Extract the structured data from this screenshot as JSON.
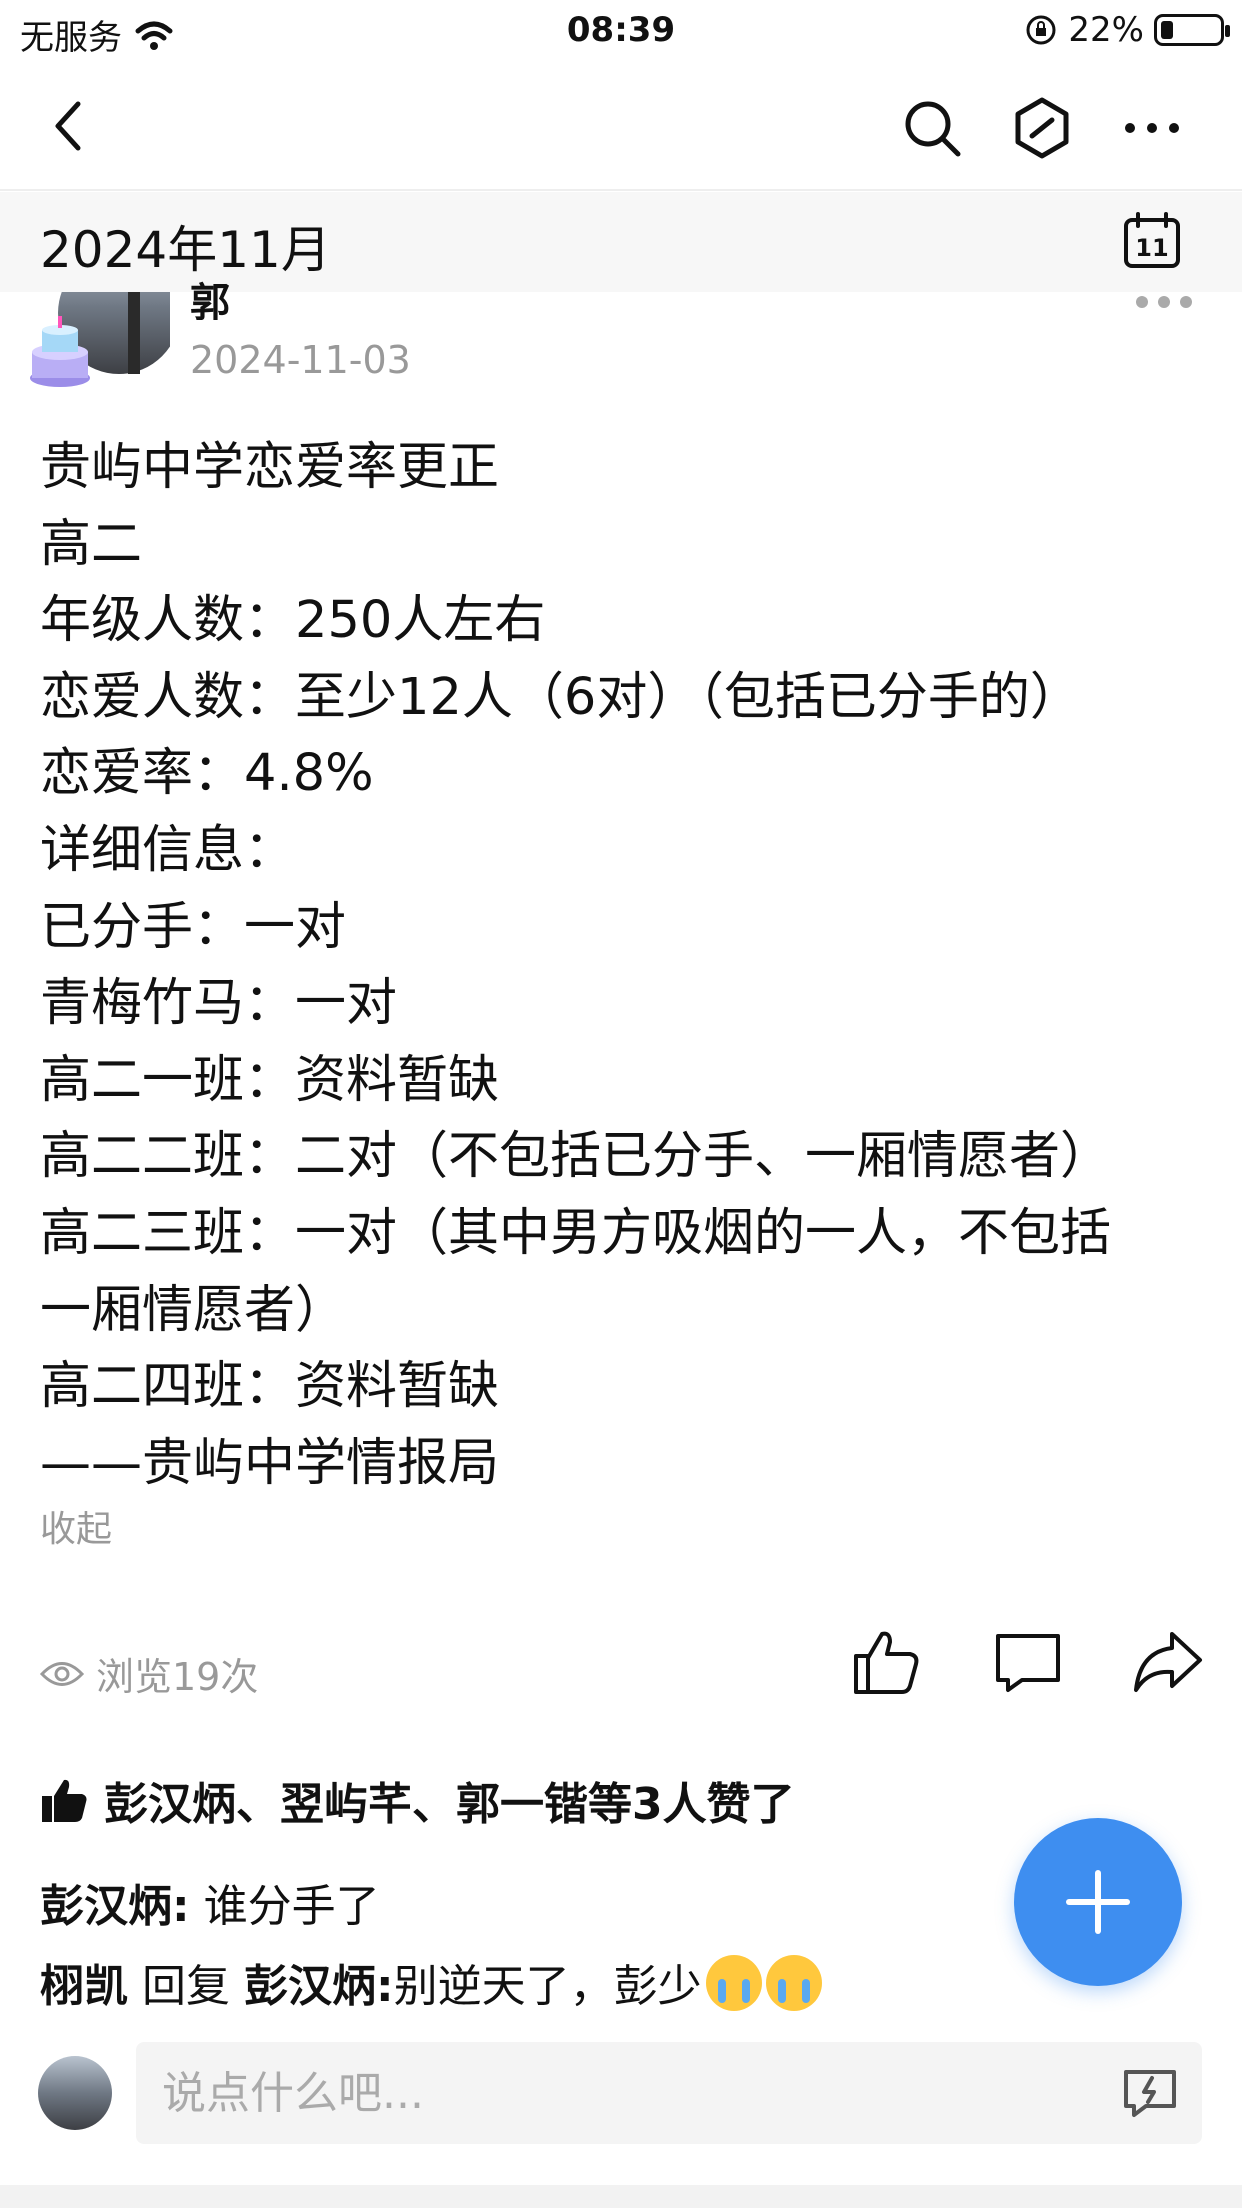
{
  "status_bar": {
    "carrier": "无服务",
    "time": "08:39",
    "battery_text": "22%",
    "battery_level": 0.22
  },
  "month_header": {
    "label": "2024年11月",
    "calendar_day": "11"
  },
  "post": {
    "author": "郭",
    "date": "2024-11-03",
    "lines": [
      "贵屿中学恋爱率更正",
      "高二",
      "年级人数：250人左右",
      "恋爱人数：至少12人（6对）（包括已分手的）",
      "恋爱率：4.8%",
      "详细信息：",
      "已分手：一对",
      "青梅竹马：一对",
      "高二一班：资料暂缺",
      "高二二班：二对（不包括已分手、一厢情愿者）",
      "高二三班：一对（其中男方吸烟的一人，不包括",
      "一厢情愿者）",
      "高二四班：资料暂缺",
      "——贵屿中学情报局"
    ],
    "collapse_label": "收起",
    "views_text": "浏览19次"
  },
  "likes_text": "彭汉炳、翌屿芊、郭一锴等3人赞了",
  "comments": [
    {
      "author": "彭汉炳:",
      "text": "谁分手了"
    },
    {
      "author": "栩凯",
      "reply_word": "回复",
      "reply_to": "彭汉炳:",
      "text": "别逆天了，彭少"
    }
  ],
  "comment_input": {
    "placeholder": "说点什么吧..."
  },
  "colors": {
    "accent": "#3e8ef0",
    "muted": "#999999"
  },
  "icons": [
    "back-icon",
    "search-icon",
    "hexagon-slash-icon",
    "more-icon",
    "calendar-icon",
    "eye-icon",
    "thumbs-up-icon",
    "comment-icon",
    "share-icon",
    "plus-icon",
    "emoji-input-icon",
    "crying-emoji"
  ]
}
